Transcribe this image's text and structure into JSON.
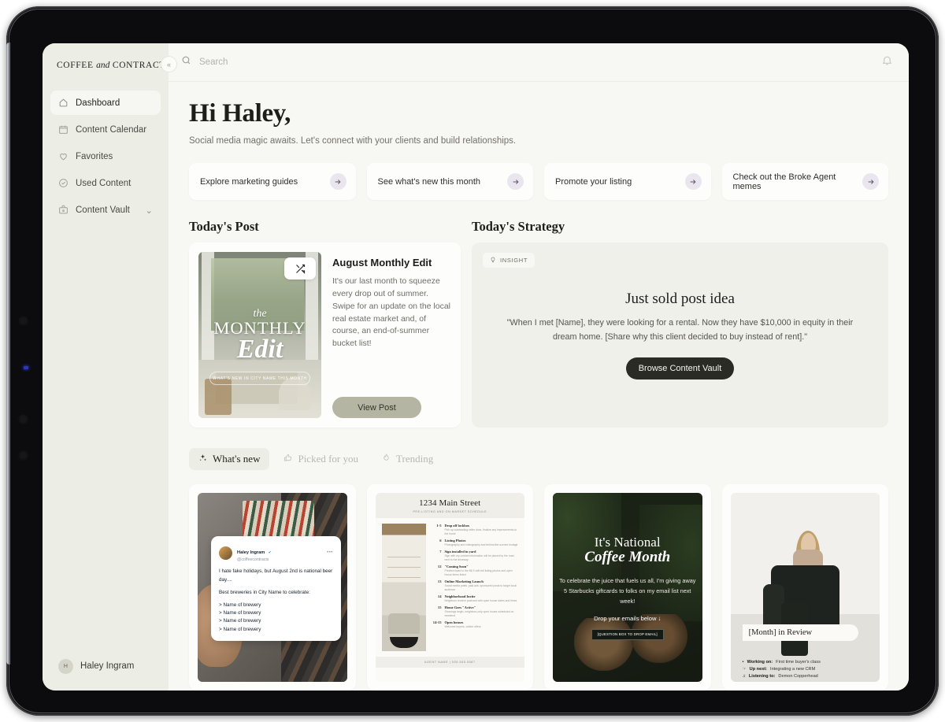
{
  "brand": {
    "part1": "COFFEE",
    "part2": "and",
    "part3": "CONTRACTS",
    "collapse_icon": "«"
  },
  "sidebar": {
    "items": [
      {
        "label": "Dashboard",
        "icon": "home-icon"
      },
      {
        "label": "Content Calendar",
        "icon": "calendar-icon"
      },
      {
        "label": "Favorites",
        "icon": "heart-icon"
      },
      {
        "label": "Used Content",
        "icon": "check-circle-icon"
      },
      {
        "label": "Content Vault",
        "icon": "vault-icon",
        "chevron": "⌄"
      }
    ],
    "user": {
      "name": "Haley Ingram",
      "initial": "H"
    }
  },
  "topbar": {
    "search_placeholder": "Search",
    "search_value": ""
  },
  "header": {
    "greeting": "Hi Haley,",
    "subtitle": "Social media magic awaits. Let's connect with your clients and build relationships."
  },
  "quicklinks": [
    {
      "label": "Explore marketing guides",
      "arrow": "→"
    },
    {
      "label": "See what's new this month",
      "arrow": "→"
    },
    {
      "label": "Promote your listing",
      "arrow": "→"
    },
    {
      "label": "Check out the Broke Agent memes",
      "arrow": "→"
    }
  ],
  "todays_post": {
    "section_title": "Today's Post",
    "title": "August Monthly Edit",
    "description": "It's our last month to squeeze every drop out of summer. Swipe for an update on the local real estate market and, of course, an end-of-summer bucket list!",
    "button": "View Post",
    "thumb": {
      "line1": "the",
      "line2": "MONTHLY",
      "line3": "Edit",
      "ribbon": "WHAT'S NEW IN CITY NAME THIS MONTH"
    }
  },
  "todays_strategy": {
    "section_title": "Today's Strategy",
    "badge": "INSIGHT",
    "title": "Just sold post idea",
    "quote": "\"When I met [Name], they were looking for a rental. Now they have $10,000 in equity in their dream home. [Share why this client decided to buy instead of rent].\"",
    "button": "Browse Content Vault"
  },
  "tabs": [
    {
      "label": "What's new",
      "icon": "sparkle-icon",
      "active": true
    },
    {
      "label": "Picked for you",
      "icon": "thumbs-up-icon",
      "active": false
    },
    {
      "label": "Trending",
      "icon": "flame-icon",
      "active": false
    }
  ],
  "content_cards": {
    "tweet": {
      "name": "Haley Ingram",
      "handle": "@coffeecontracts",
      "line1": "I hate fake holidays, but August 2nd is national beer day....",
      "line2": "Best breweries in City Name to celebrate:",
      "list": [
        "> Name of brewery",
        "> Name of brewery",
        "> Name of brewery",
        "> Name of brewery"
      ]
    },
    "listing": {
      "title": "1234 Main Street",
      "subtitle": "PRE-LISTING AND ON-MARKET SCHEDULE",
      "rows": [
        {
          "day": "1-5",
          "head": "Drop off lockbox",
          "text": "Pick up outstanding seller docs, finalize any improvements to the home"
        },
        {
          "day": "6",
          "head": "Listing Photos",
          "text": "Photography and videography and behind-the-scenes footage"
        },
        {
          "day": "7",
          "head": "Sign installed in yard",
          "text": "Sign with my contact information will be placed by the road next to the driveway"
        },
        {
          "day": "12",
          "head": "\"Coming Soon\"",
          "text": "Preview listed in the MLS with full listing photos and open house times listed"
        },
        {
          "day": "13",
          "head": "Online Marketing Launch",
          "text": "Social media posts, paid ads, sponsored posts to target local audience"
        },
        {
          "day": "14",
          "head": "Neighborhood Invite",
          "text": "Neighbors receive postcard with open house dates and times"
        },
        {
          "day": "15",
          "head": "Home Goes \"Active\"",
          "text": "Showings begin, neighbors-only open house scheduled on weekend"
        },
        {
          "day": "14-15",
          "head": "Open houses",
          "text": "Welcome buyers, collect offers"
        }
      ],
      "footer": "AGENT NAME  |  555.555.5587"
    },
    "coffee": {
      "line1": "It's National",
      "line2": "Coffee Month",
      "body": "To celebrate the juice that fuels us all, I'm giving away 5 Starbucks giftcards to folks on my email list next week!",
      "drop": "Drop your emails below ↓",
      "chip": "[QUESTION BOX TO DROP EMAIL]"
    },
    "review": {
      "label": "[Month] in Review",
      "items": [
        {
          "emoji": "▪",
          "label": "Working on:",
          "value": "First time buyer's class"
        },
        {
          "emoji": "☞",
          "label": "Up next:",
          "value": "Integrating a new CRM"
        },
        {
          "emoji": "♫",
          "label": "Listening to:",
          "value": "Demon Copperhead"
        }
      ]
    }
  },
  "colors": {
    "sidebar_bg": "#eceee6",
    "app_bg": "#f7f7f3",
    "card_bg": "#fdfdfb",
    "accent_lavender": "#e9e6f0",
    "sage_button": "#b5b5a3",
    "dark_button": "#2b2b26"
  }
}
